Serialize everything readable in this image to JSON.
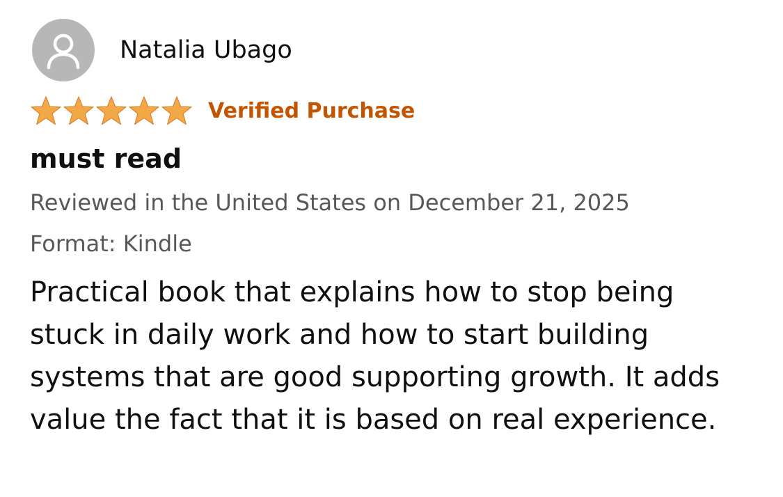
{
  "reviewer": {
    "name": "Natalia Ubago",
    "avatar_icon": "person-icon"
  },
  "rating": {
    "stars": 5,
    "max_stars": 5,
    "star_color": "#f3a847",
    "star_icon": "star-icon"
  },
  "verified_label": "Verified Purchase",
  "verified_color": "#c45500",
  "title": "must read",
  "date_text": "Reviewed in the United States on December 21, 2025",
  "format_text": "Format: Kindle",
  "body": "Practical book that explains how to stop being stuck in daily work and how to start building systems that are good supporting growth. It adds value the fact that it is based on real experience.",
  "colors": {
    "avatar_bg": "#b7b7b7",
    "meta_text": "#565959",
    "primary_text": "#0f1111"
  }
}
